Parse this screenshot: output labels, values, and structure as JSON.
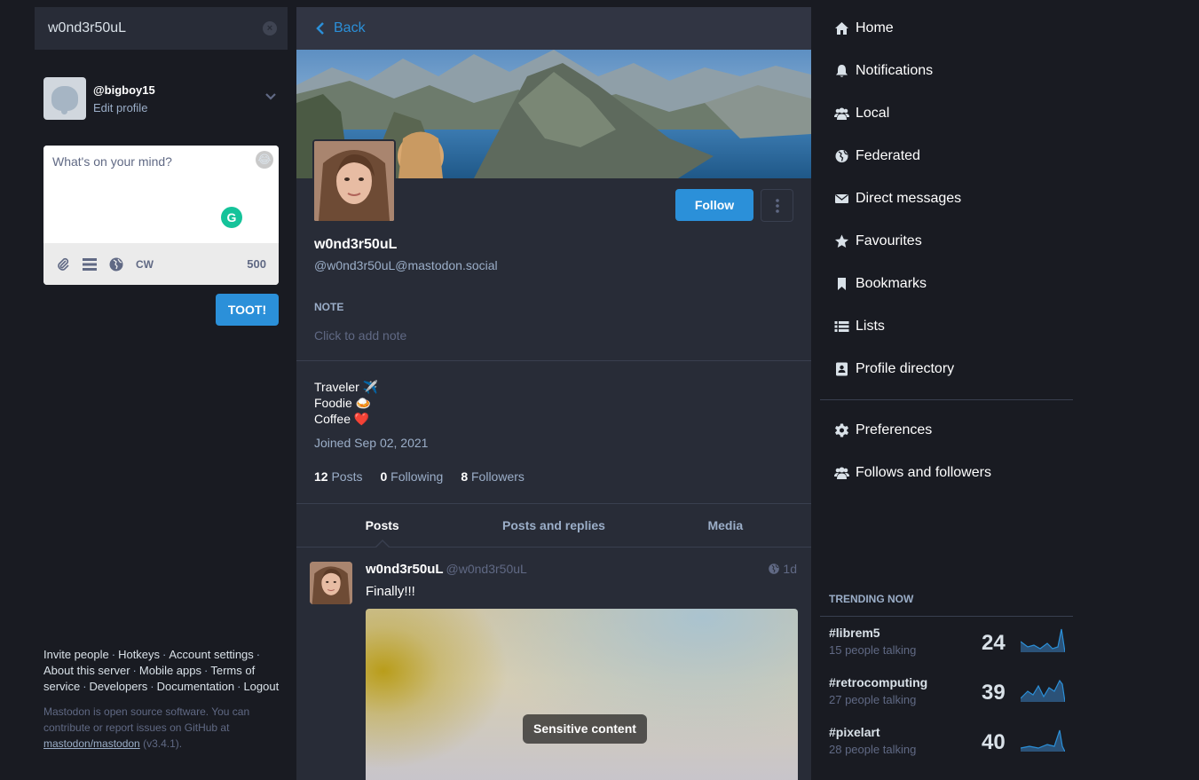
{
  "search": {
    "value": "w0nd3r50uL",
    "clear_glyph": "×"
  },
  "me": {
    "handle": "@bigboy15",
    "edit_label": "Edit profile"
  },
  "compose": {
    "placeholder": "What's on your mind?",
    "grammarly_glyph": "G",
    "cw_label": "CW",
    "char_counter": "500",
    "toot_label": "TOOT!"
  },
  "footer": {
    "links": [
      "Invite people",
      "Hotkeys",
      "Account settings",
      "About this server",
      "Mobile apps",
      "Terms of service",
      "Developers",
      "Documentation",
      "Logout"
    ],
    "about_prefix": "Mastodon is open source software. You can contribute or report issues on GitHub at",
    "about_link": "mastodon/mastodon",
    "about_suffix": "(v3.4.1)."
  },
  "header": {
    "back_label": "Back"
  },
  "profile": {
    "display_name": "w0nd3r50uL",
    "acct": "@w0nd3r50uL@mastodon.social",
    "follow_label": "Follow",
    "note_label": "NOTE",
    "note_placeholder": "Click to add note",
    "bio": [
      "Traveler ✈️",
      "Foodie 🍛",
      "Coffee ❤️"
    ],
    "joined": "Joined Sep 02, 2021",
    "counts": [
      {
        "num": "12",
        "label": "Posts"
      },
      {
        "num": "0",
        "label": "Following"
      },
      {
        "num": "8",
        "label": "Followers"
      }
    ]
  },
  "tabs": [
    "Posts",
    "Posts and replies",
    "Media"
  ],
  "status": {
    "display_name": "w0nd3r50uL",
    "acct": "@w0nd3r50uL",
    "time": "1d",
    "content": "Finally!!!",
    "sensitive_label": "Sensitive content"
  },
  "nav": {
    "primary": [
      {
        "label": "Home",
        "icon": "home-icon"
      },
      {
        "label": "Notifications",
        "icon": "bell-icon"
      },
      {
        "label": "Local",
        "icon": "users-icon"
      },
      {
        "label": "Federated",
        "icon": "globe-icon"
      },
      {
        "label": "Direct messages",
        "icon": "envelope-icon"
      },
      {
        "label": "Favourites",
        "icon": "star-icon"
      },
      {
        "label": "Bookmarks",
        "icon": "bookmark-icon"
      },
      {
        "label": "Lists",
        "icon": "list-icon"
      },
      {
        "label": "Profile directory",
        "icon": "address-book-icon"
      }
    ],
    "secondary": [
      {
        "label": "Preferences",
        "icon": "gear-icon"
      },
      {
        "label": "Follows and followers",
        "icon": "users-icon"
      }
    ]
  },
  "trending": {
    "title": "TRENDING NOW",
    "items": [
      {
        "tag": "#librem5",
        "people": "15 people talking",
        "count": "24"
      },
      {
        "tag": "#retrocomputing",
        "people": "27 people talking",
        "count": "39"
      },
      {
        "tag": "#pixelart",
        "people": "28 people talking",
        "count": "40"
      }
    ]
  },
  "colors": {
    "accent": "#2b90d9",
    "bg": "#191b22",
    "panel": "#282c37"
  }
}
